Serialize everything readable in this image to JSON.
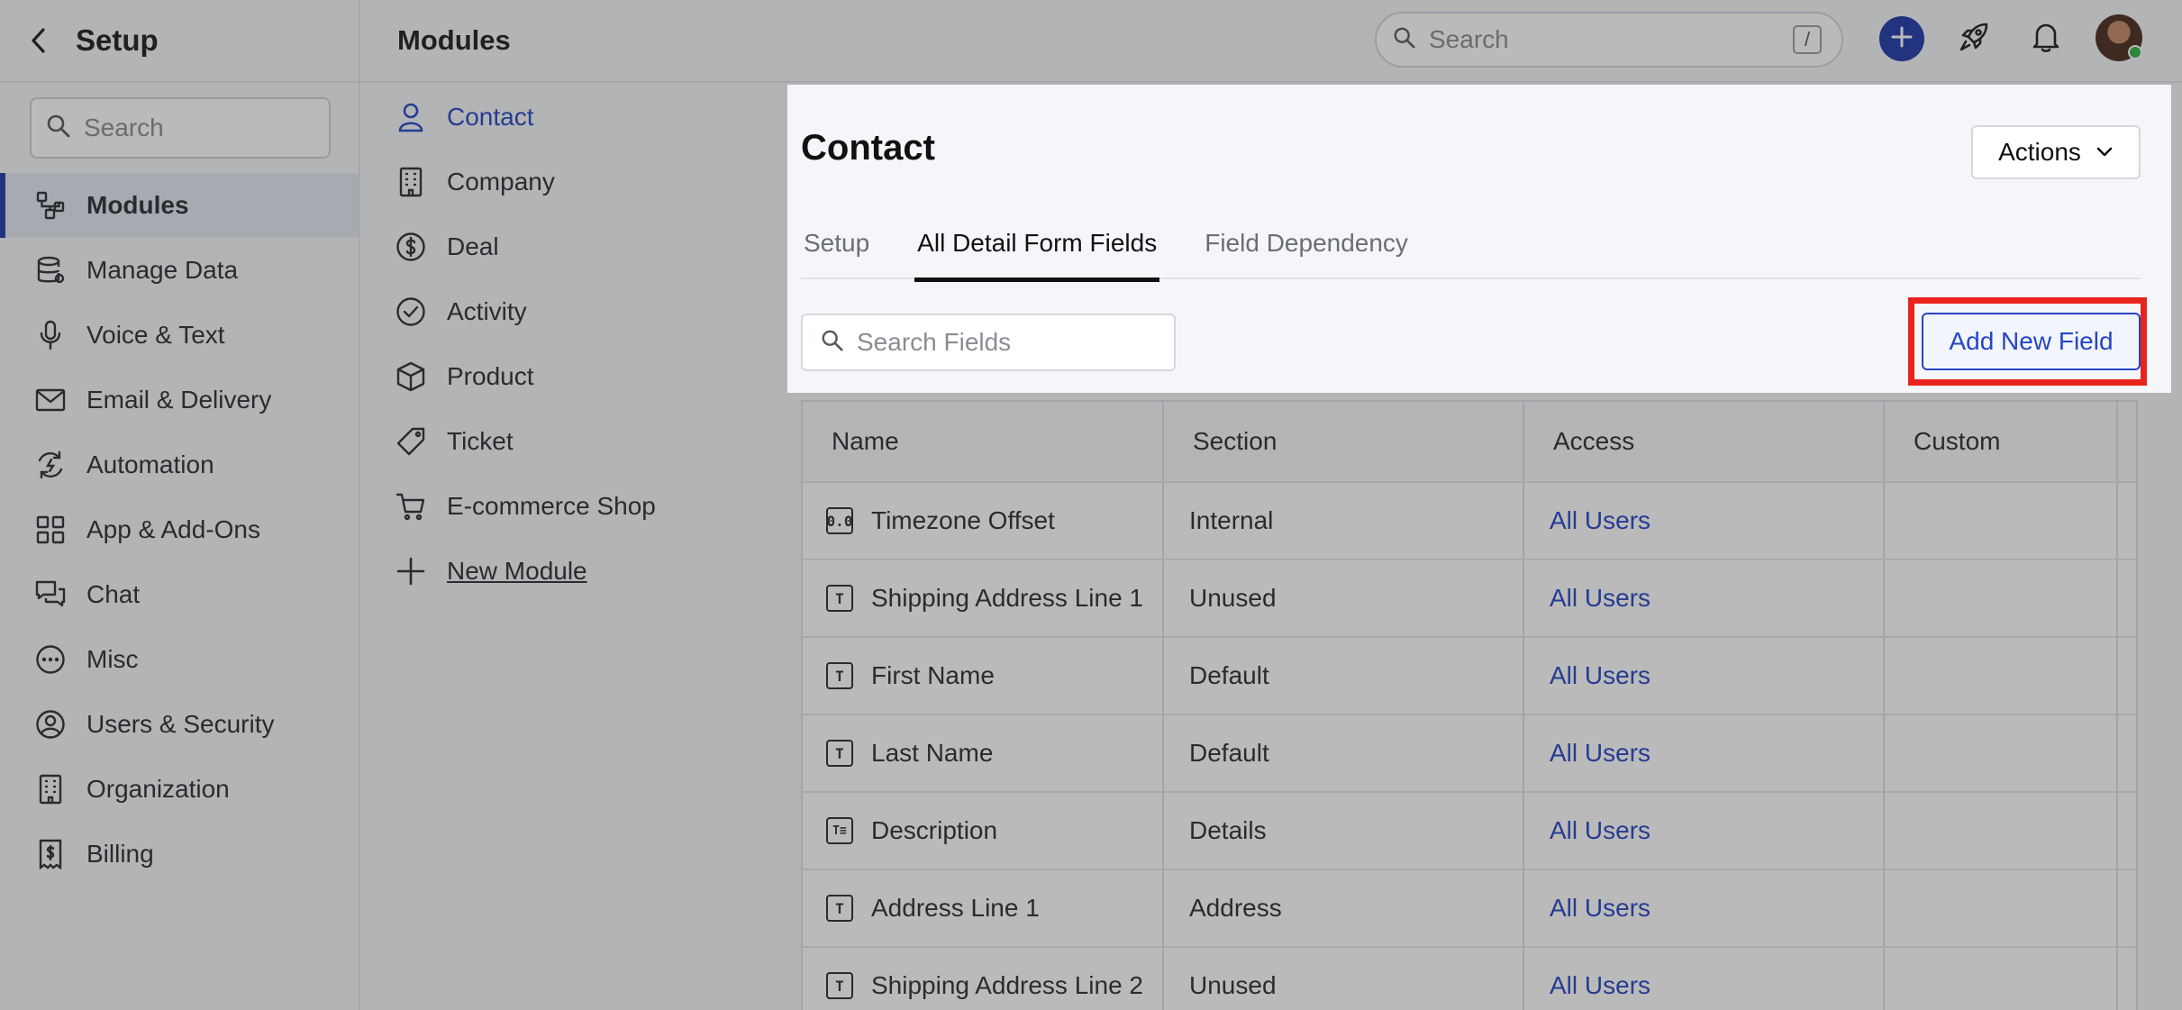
{
  "sidebar": {
    "title": "Setup",
    "search_placeholder": "Search",
    "items": [
      {
        "label": "Modules",
        "icon": "modules-icon",
        "active": true
      },
      {
        "label": "Manage Data",
        "icon": "database-icon"
      },
      {
        "label": "Voice & Text",
        "icon": "microphone-icon"
      },
      {
        "label": "Email & Delivery",
        "icon": "envelope-icon"
      },
      {
        "label": "Automation",
        "icon": "automation-icon"
      },
      {
        "label": "App & Add-Ons",
        "icon": "apps-grid-icon"
      },
      {
        "label": "Chat",
        "icon": "chat-bubbles-icon"
      },
      {
        "label": "Misc",
        "icon": "more-dots-icon"
      },
      {
        "label": "Users & Security",
        "icon": "user-circle-icon"
      },
      {
        "label": "Organization",
        "icon": "building-icon"
      },
      {
        "label": "Billing",
        "icon": "billing-icon"
      }
    ]
  },
  "header": {
    "title": "Modules",
    "search_placeholder": "Search",
    "search_shortcut": "/"
  },
  "modules": [
    {
      "label": "Contact",
      "icon": "person-icon",
      "active": true
    },
    {
      "label": "Company",
      "icon": "building-icon"
    },
    {
      "label": "Deal",
      "icon": "dollar-icon"
    },
    {
      "label": "Activity",
      "icon": "check-circle-icon"
    },
    {
      "label": "Product",
      "icon": "box-icon"
    },
    {
      "label": "Ticket",
      "icon": "ticket-icon"
    },
    {
      "label": "E-commerce Shop",
      "icon": "cart-icon"
    },
    {
      "label": "New Module",
      "icon": "plus-icon"
    }
  ],
  "panel": {
    "title": "Contact",
    "actions_label": "Actions",
    "tabs": [
      "Setup",
      "All Detail Form Fields",
      "Field Dependency"
    ],
    "active_tab": "All Detail Form Fields",
    "field_search_placeholder": "Search Fields",
    "add_field_label": "Add New Field"
  },
  "table": {
    "headers": [
      "Name",
      "Section",
      "Access",
      "Custom"
    ],
    "rows": [
      {
        "name": "Timezone Offset",
        "type_glyph": "0.0",
        "section": "Internal",
        "access": "All Users"
      },
      {
        "name": "Shipping Address Line 1",
        "type_glyph": "T",
        "section": "Unused",
        "access": "All Users"
      },
      {
        "name": "First Name",
        "type_glyph": "T",
        "section": "Default",
        "access": "All Users"
      },
      {
        "name": "Last Name",
        "type_glyph": "T",
        "section": "Default",
        "access": "All Users"
      },
      {
        "name": "Description",
        "type_glyph": "T≡",
        "section": "Details",
        "access": "All Users"
      },
      {
        "name": "Address Line 1",
        "type_glyph": "T",
        "section": "Address",
        "access": "All Users"
      },
      {
        "name": "Shipping Address Line 2",
        "type_glyph": "T",
        "section": "Unused",
        "access": "All Users"
      }
    ]
  },
  "colors": {
    "accent": "#2546c5",
    "highlight": "#e8231c",
    "status_online": "#2fb344"
  }
}
